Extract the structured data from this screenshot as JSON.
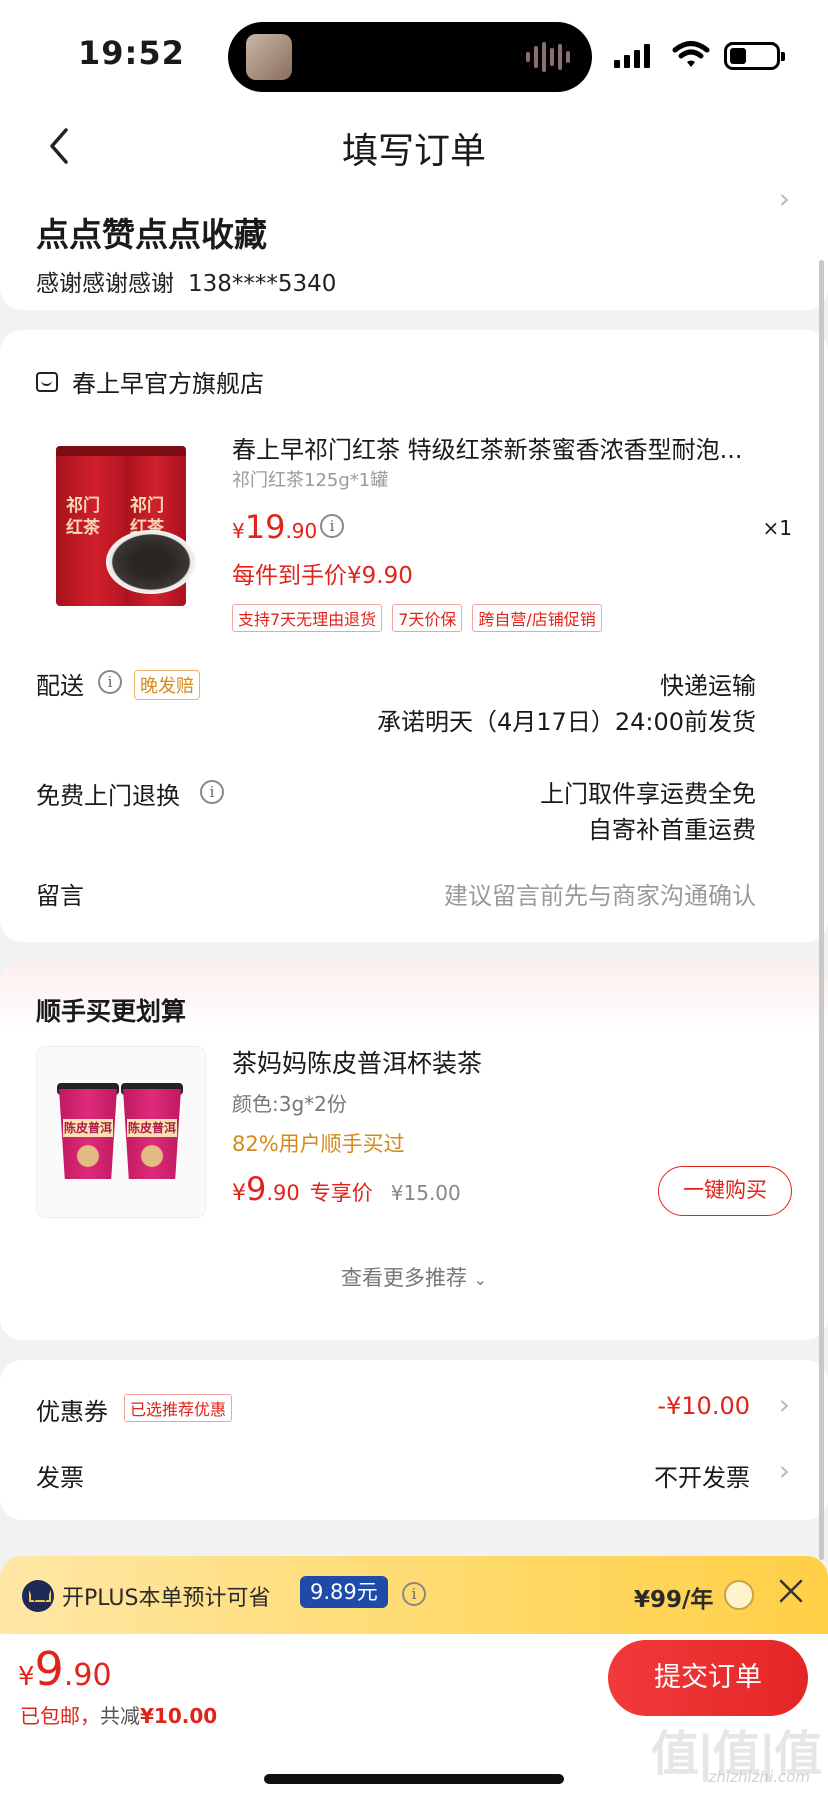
{
  "status_bar": {
    "time": "19:52"
  },
  "nav": {
    "title": "填写订单"
  },
  "address": {
    "name": "点点赞点点收藏",
    "contact": "感谢感谢感谢",
    "phone": "138****5340"
  },
  "shop": {
    "name": "春上早官方旗舰店"
  },
  "product": {
    "title": "春上早祁门红茶 特级红茶新茶蜜香浓香型耐泡...",
    "spec": "祁门红茶125g*1罐",
    "price_symbol": "¥",
    "price_int": "19",
    "price_dec": ".90",
    "quantity": "×1",
    "each_price": "每件到手价¥9.90",
    "tags": [
      "支持7天无理由退货",
      "7天价保",
      "跨自营/店铺促销"
    ],
    "can_label": "祁门\n红茶"
  },
  "delivery": {
    "label": "配送",
    "late_tag": "晚发赔",
    "method": "快递运输",
    "promise": "承诺明天（4月17日）24:00前发货"
  },
  "return_service": {
    "label": "免费上门退换",
    "line1": "上门取件享运费全免",
    "line2": "自寄补首重运费"
  },
  "message": {
    "label": "留言",
    "placeholder": "建议留言前先与商家沟通确认"
  },
  "recommend": {
    "title": "顺手买更划算",
    "name": "茶妈妈陈皮普洱杯装茶",
    "spec": "颜色:3g*2份",
    "bought": "82%用户顺手买过",
    "price_symbol": "¥",
    "price_int": "9",
    "price_dec": ".90",
    "price_label": "专享价",
    "original_price": "¥15.00",
    "buy_button": "一键购买",
    "more": "查看更多推荐",
    "cup_label": "陈皮普洱"
  },
  "coupon": {
    "label": "优惠券",
    "tag": "已选推荐优惠",
    "value": "-¥10.00"
  },
  "invoice": {
    "label": "发票",
    "value": "不开发票"
  },
  "plus": {
    "text": "开PLUS本单预计可省",
    "save": "9.89元",
    "price": "¥99/年"
  },
  "bottom": {
    "price_symbol": "¥",
    "price_int": "9",
    "price_dec": ".90",
    "shipping": "已包邮，",
    "discount_prefix": "共减",
    "discount": "¥10.00",
    "submit": "提交订单"
  },
  "watermark": {
    "main": "值|值|值",
    "sub": "zhizhizhi.com"
  },
  "colors": {
    "accent": "#e2231a",
    "plus_gold": "#ffd968",
    "plus_blue": "#1e4aa8"
  }
}
